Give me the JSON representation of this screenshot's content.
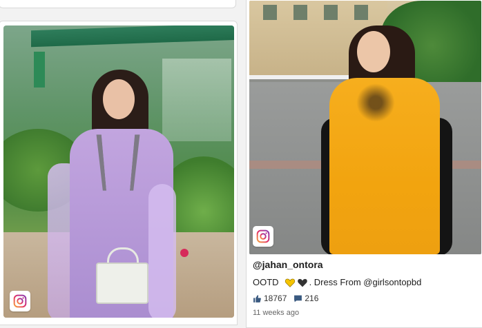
{
  "posts": [
    {
      "platform_icon": "instagram-icon"
    },
    {
      "platform_icon": "instagram-icon",
      "username": "@jahan_ontora",
      "caption_prefix": "OOTD",
      "caption_hearts": [
        "yellow-heart",
        "black-heart"
      ],
      "caption_suffix": ". Dress From @girlsontopbd",
      "likes": "18767",
      "comments": "216",
      "time_ago": "11 weeks ago"
    }
  ],
  "colors": {
    "yellow_heart": "#f5c400",
    "black_heart": "#333333",
    "like_icon": "#3a5a80",
    "comment_icon": "#3a5a80"
  }
}
